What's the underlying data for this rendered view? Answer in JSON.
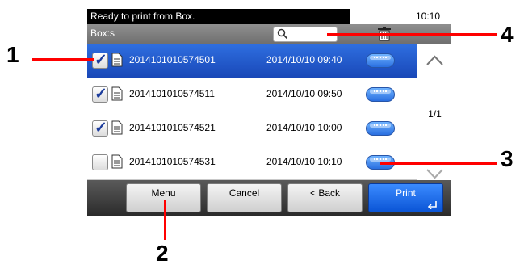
{
  "status": {
    "message": "Ready to print from Box.",
    "time": "10:10"
  },
  "header": {
    "title": "Box:s"
  },
  "files": [
    {
      "name": "2014101010574501",
      "date": "2014/10/10 09:40",
      "checked": true,
      "selected": true
    },
    {
      "name": "2014101010574511",
      "date": "2014/10/10 09:50",
      "checked": true,
      "selected": false
    },
    {
      "name": "2014101010574521",
      "date": "2014/10/10 10:00",
      "checked": true,
      "selected": false
    },
    {
      "name": "2014101010574531",
      "date": "2014/10/10 10:10",
      "checked": false,
      "selected": false
    }
  ],
  "pager": {
    "indicator": "1/1"
  },
  "buttons": {
    "menu": "Menu",
    "cancel": "Cancel",
    "back": "< Back",
    "print": "Print"
  },
  "callouts": {
    "c1": "1",
    "c2": "2",
    "c3": "3",
    "c4": "4"
  },
  "colors": {
    "selected_row": "#1948b8",
    "callout_line": "#ff0000",
    "print_button": "#0b55d6"
  },
  "icons": {
    "search": "search-icon",
    "trash": "trash-icon",
    "doc": "document-icon",
    "detail": "detail-icon",
    "scroll_up": "chevron-up-icon",
    "scroll_down": "chevron-down-icon",
    "enter": "enter-icon"
  }
}
